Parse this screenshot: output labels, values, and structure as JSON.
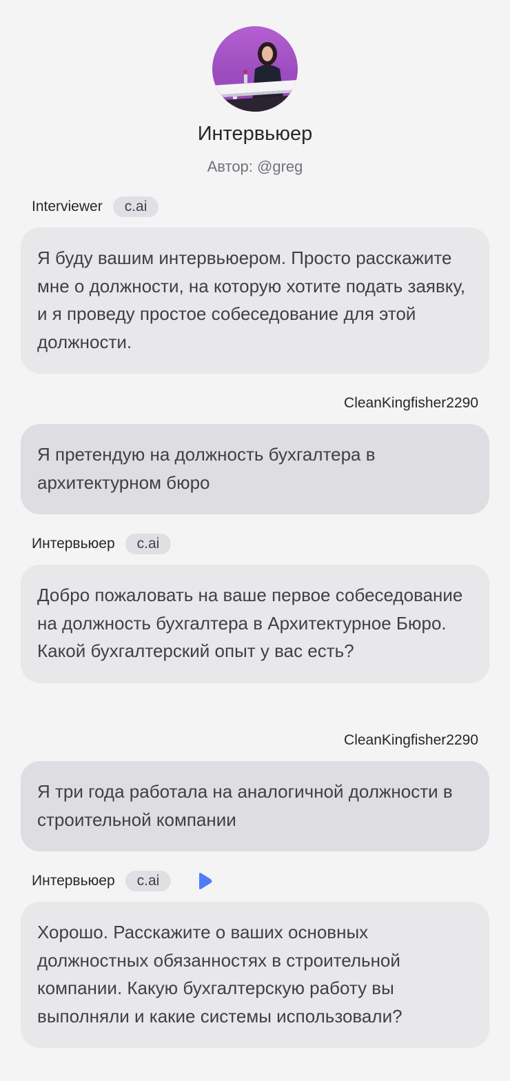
{
  "profile": {
    "name": "Интервьюер",
    "author": "Автор: @greg"
  },
  "messages": [
    {
      "role": "bot",
      "sender": "Interviewer",
      "tag": "c.ai",
      "text": "Я буду вашим интервьюером. Просто расскажите мне о должности, на которую хотите подать заявку, и я проведу простое собеседование для этой должности."
    },
    {
      "role": "user",
      "sender": "CleanKingfisher2290",
      "text": "Я претендую на должность бухгалтера в архитектурном бюро"
    },
    {
      "role": "bot",
      "sender": "Интервьюер",
      "tag": "c.ai",
      "text": "Добро пожаловать на ваше первое собеседование на должность бухгалтера в Архитектурное Бюро. Какой бухгалтерский опыт у вас есть?"
    },
    {
      "role": "user",
      "sender": "CleanKingfisher2290",
      "text": "Я три года работала на аналогичной должности в строительной компании"
    },
    {
      "role": "bot",
      "sender": "Интервьюер",
      "tag": "c.ai",
      "icon": "play-icon",
      "text": "Хорошо. Расскажите о ваших основных должностных обязанностях в строительной компании. Какую бухгалтерскую работу вы выполняли и какие системы использовали?"
    }
  ],
  "colors": {
    "background": "#f4f4f5",
    "bot_bubble": "#e8e8ea",
    "user_bubble": "#dedde2",
    "tag_bg": "#e0e0e4",
    "play_accent": "#4f7cf7",
    "avatar_bg": "#a855c8"
  }
}
